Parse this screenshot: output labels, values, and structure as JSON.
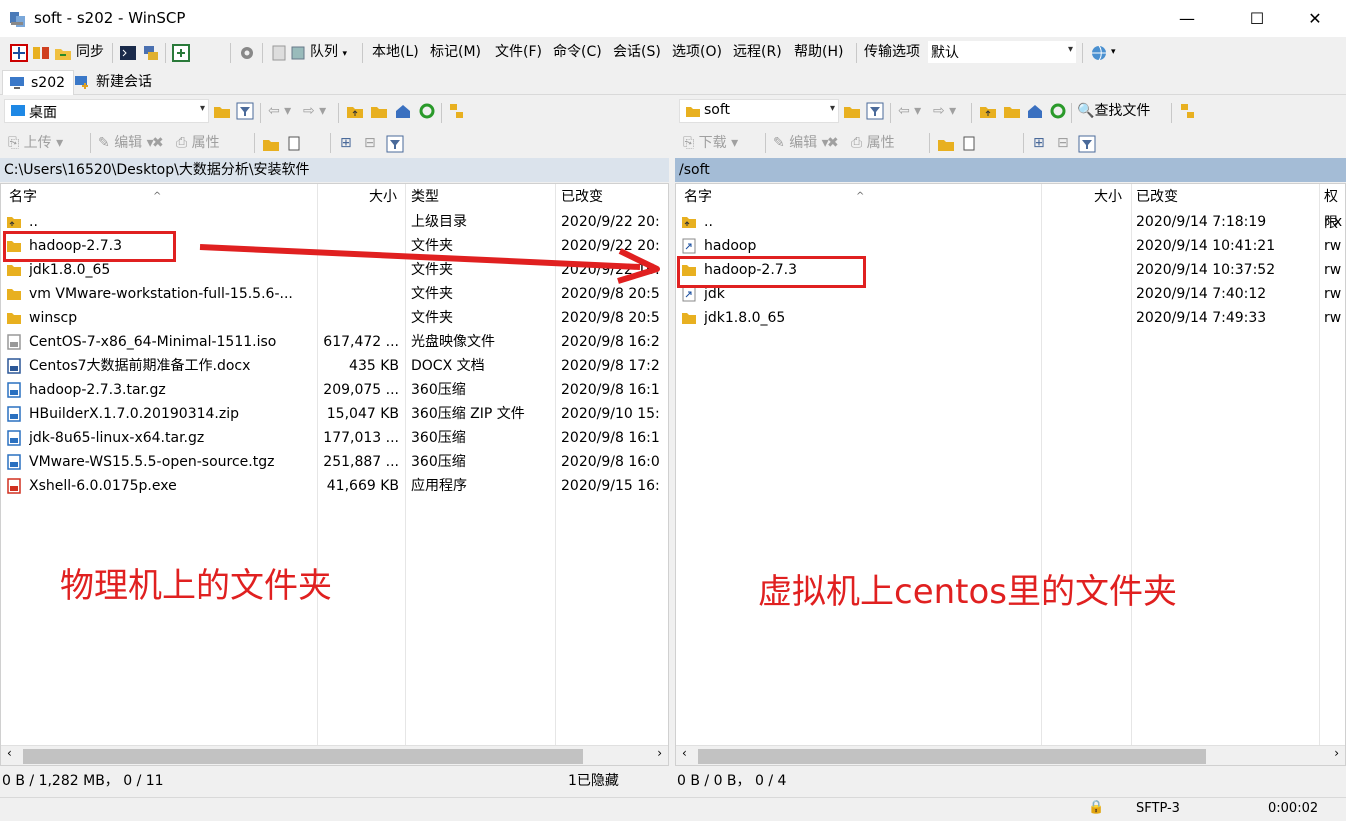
{
  "window": {
    "title": "soft - s202 - WinSCP",
    "minimize": "—",
    "maximize": "☐",
    "close": "✕"
  },
  "toolbar": {
    "sync_label": "同步",
    "queue_label": "队列",
    "menus": [
      "本地(L)",
      "标记(M)",
      "文件(F)",
      "命令(C)",
      "会话(S)",
      "选项(O)",
      "远程(R)",
      "帮助(H)"
    ],
    "transfer_label": "传输选项",
    "transfer_value": "默认"
  },
  "tabs": [
    {
      "label": "s202"
    },
    {
      "label": "新建会话"
    }
  ],
  "left": {
    "location": "桌面",
    "upload": "上传",
    "edit": "编辑",
    "properties": "属性",
    "path": "C:\\Users\\16520\\Desktop\\大数据分析\\安装软件",
    "headers": {
      "name": "名字",
      "size": "大小",
      "type": "类型",
      "changed": "已改变"
    },
    "rows": [
      {
        "name": "..",
        "size": "",
        "type": "上级目录",
        "changed": "2020/9/22  20:"
      },
      {
        "name": "hadoop-2.7.3",
        "size": "",
        "type": "文件夹",
        "changed": "2020/9/22  20:"
      },
      {
        "name": "jdk1.8.0_65",
        "size": "",
        "type": "文件夹",
        "changed": "2020/9/22  16:"
      },
      {
        "name": "vm  VMware-workstation-full-15.5.6-...",
        "size": "",
        "type": "文件夹",
        "changed": "2020/9/8  20:5"
      },
      {
        "name": "winscp",
        "size": "",
        "type": "文件夹",
        "changed": "2020/9/8  20:5"
      },
      {
        "name": "CentOS-7-x86_64-Minimal-1511.iso",
        "size": "617,472 ...",
        "type": "光盘映像文件",
        "changed": "2020/9/8  16:2"
      },
      {
        "name": "Centos7大数据前期准备工作.docx",
        "size": "435 KB",
        "type": "DOCX 文档",
        "changed": "2020/9/8  17:2"
      },
      {
        "name": "hadoop-2.7.3.tar.gz",
        "size": "209,075 ...",
        "type": "360压缩",
        "changed": "2020/9/8  16:1"
      },
      {
        "name": "HBuilderX.1.7.0.20190314.zip",
        "size": "15,047 KB",
        "type": "360压缩 ZIP 文件",
        "changed": "2020/9/10  15:"
      },
      {
        "name": "jdk-8u65-linux-x64.tar.gz",
        "size": "177,013 ...",
        "type": "360压缩",
        "changed": "2020/9/8  16:1"
      },
      {
        "name": "VMware-WS15.5.5-open-source.tgz",
        "size": "251,887 ...",
        "type": "360压缩",
        "changed": "2020/9/8  16:0"
      },
      {
        "name": "Xshell-6.0.0175p.exe",
        "size": "41,669 KB",
        "type": "应用程序",
        "changed": "2020/9/15  16:"
      }
    ],
    "status_left": "0 B / 1,282 MB，  0 / 11",
    "status_right": "1已隐藏"
  },
  "right": {
    "location": "soft",
    "download": "下载",
    "edit": "编辑",
    "properties": "属性",
    "find": "查找文件",
    "path": "/soft",
    "headers": {
      "name": "名字",
      "size": "大小",
      "changed": "已改变",
      "rights": "权限"
    },
    "rows": [
      {
        "name": "..",
        "size": "",
        "changed": "2020/9/14 7:18:19",
        "rights": "r-x"
      },
      {
        "name": "hadoop",
        "size": "",
        "changed": "2020/9/14 10:41:21",
        "rights": "rw"
      },
      {
        "name": "hadoop-2.7.3",
        "size": "",
        "changed": "2020/9/14 10:37:52",
        "rights": "rw"
      },
      {
        "name": "jdk",
        "size": "",
        "changed": "2020/9/14 7:40:12",
        "rights": "rw"
      },
      {
        "name": "jdk1.8.0_65",
        "size": "",
        "changed": "2020/9/14 7:49:33",
        "rights": "rw"
      }
    ],
    "status_left": "0 B / 0 B，  0 / 4"
  },
  "annotations": {
    "left_label": "物理机上的文件夹",
    "right_label": "虚拟机上centos里的文件夹",
    "color": "#e02020"
  },
  "statusbar": {
    "protocol": "SFTP-3",
    "time": "0:00:02"
  }
}
